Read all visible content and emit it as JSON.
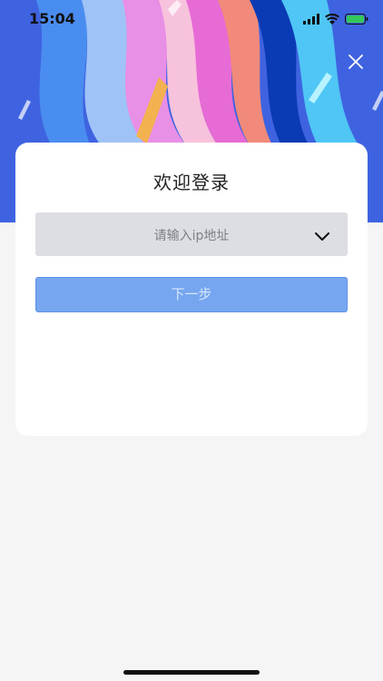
{
  "status": {
    "time": "15:04",
    "icons": [
      "signal-icon",
      "wifi-icon",
      "battery-icon"
    ],
    "battery_color": "#35c759"
  },
  "header": {
    "close_icon": "close-icon"
  },
  "login": {
    "title": "欢迎登录",
    "ip_select_placeholder": "请输入ip地址",
    "dropdown_icon": "chevron-down-icon",
    "next_button_label": "下一步"
  },
  "colors": {
    "primary_button": "#76a6f0",
    "hero_background": "#3f63e0",
    "page_background": "#f5f5f5"
  }
}
